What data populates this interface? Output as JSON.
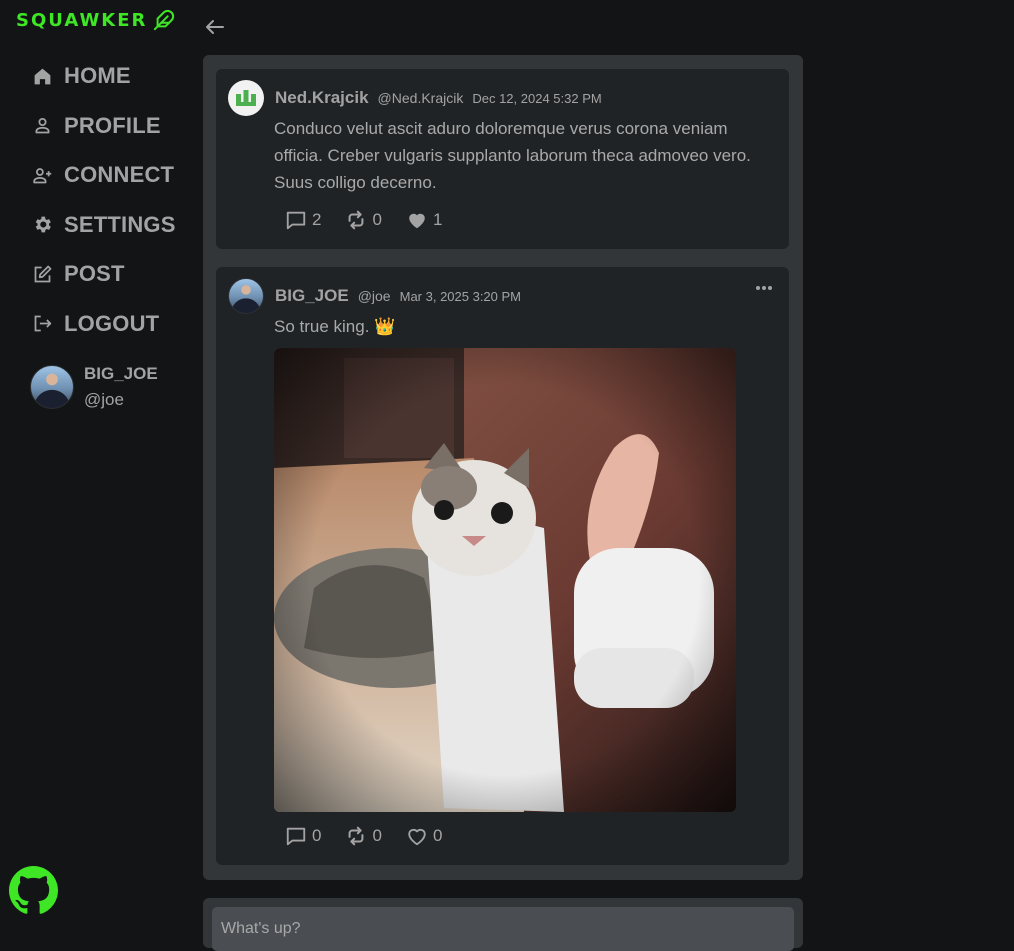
{
  "app": {
    "name": "SQUAWKER",
    "brand_color": "#3ee626"
  },
  "sidebar": {
    "items": [
      {
        "label": "HOME",
        "icon": "home-icon"
      },
      {
        "label": "PROFILE",
        "icon": "person-icon"
      },
      {
        "label": "CONNECT",
        "icon": "add-person-icon"
      },
      {
        "label": "SETTINGS",
        "icon": "gear-icon"
      },
      {
        "label": "POST",
        "icon": "edit-icon"
      },
      {
        "label": "LOGOUT",
        "icon": "logout-icon"
      }
    ],
    "user": {
      "name": "BIG_JOE",
      "handle": "@joe"
    }
  },
  "thread": {
    "posts": [
      {
        "author": "Ned.Krajcik",
        "handle": "@Ned.Krajcik",
        "date": "Dec 12, 2024 5:32 PM",
        "text": "Conduco velut ascit aduro doloremque verus corona veniam officia. Creber vulgaris supplanto laborum theca admoveo vero. Suus colligo decerno.",
        "comments": "2",
        "reposts": "0",
        "likes": "1",
        "liked": true
      },
      {
        "author": "BIG_JOE",
        "handle": "@joe",
        "date": "Mar 3, 2025 3:20 PM",
        "text": "So true king. 👑",
        "image": "cat-thumbs-up-photo",
        "comments": "0",
        "reposts": "0",
        "likes": "0",
        "liked": false
      }
    ]
  },
  "composer": {
    "placeholder": "What's up?"
  }
}
